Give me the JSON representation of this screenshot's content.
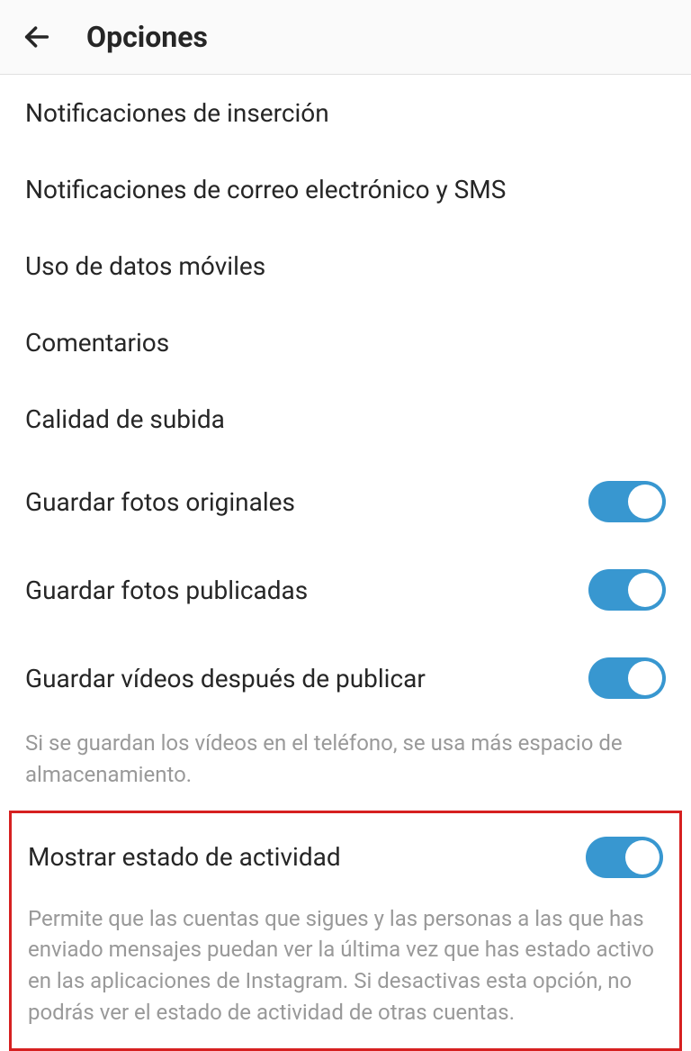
{
  "header": {
    "title": "Opciones"
  },
  "items": [
    {
      "label": "Notificaciones de inserción",
      "has_toggle": false
    },
    {
      "label": "Notificaciones de correo electrónico y SMS",
      "has_toggle": false
    },
    {
      "label": "Uso de datos móviles",
      "has_toggle": false
    },
    {
      "label": "Comentarios",
      "has_toggle": false
    },
    {
      "label": "Calidad de subida",
      "has_toggle": false
    },
    {
      "label": "Guardar fotos originales",
      "has_toggle": true,
      "toggle_on": true
    },
    {
      "label": "Guardar fotos publicadas",
      "has_toggle": true,
      "toggle_on": true
    },
    {
      "label": "Guardar vídeos después de publicar",
      "has_toggle": true,
      "toggle_on": true
    }
  ],
  "video_description": "Si se guardan los vídeos en el teléfono, se usa más espacio de almacenamiento.",
  "highlighted": {
    "label": "Mostrar estado de actividad",
    "toggle_on": true,
    "description": "Permite que las cuentas que sigues y las personas a las que has enviado mensajes puedan ver la última vez que has estado activo en las aplicaciones de Instagram. Si desactivas esta opción, no podrás ver el estado de actividad de otras cuentas."
  }
}
